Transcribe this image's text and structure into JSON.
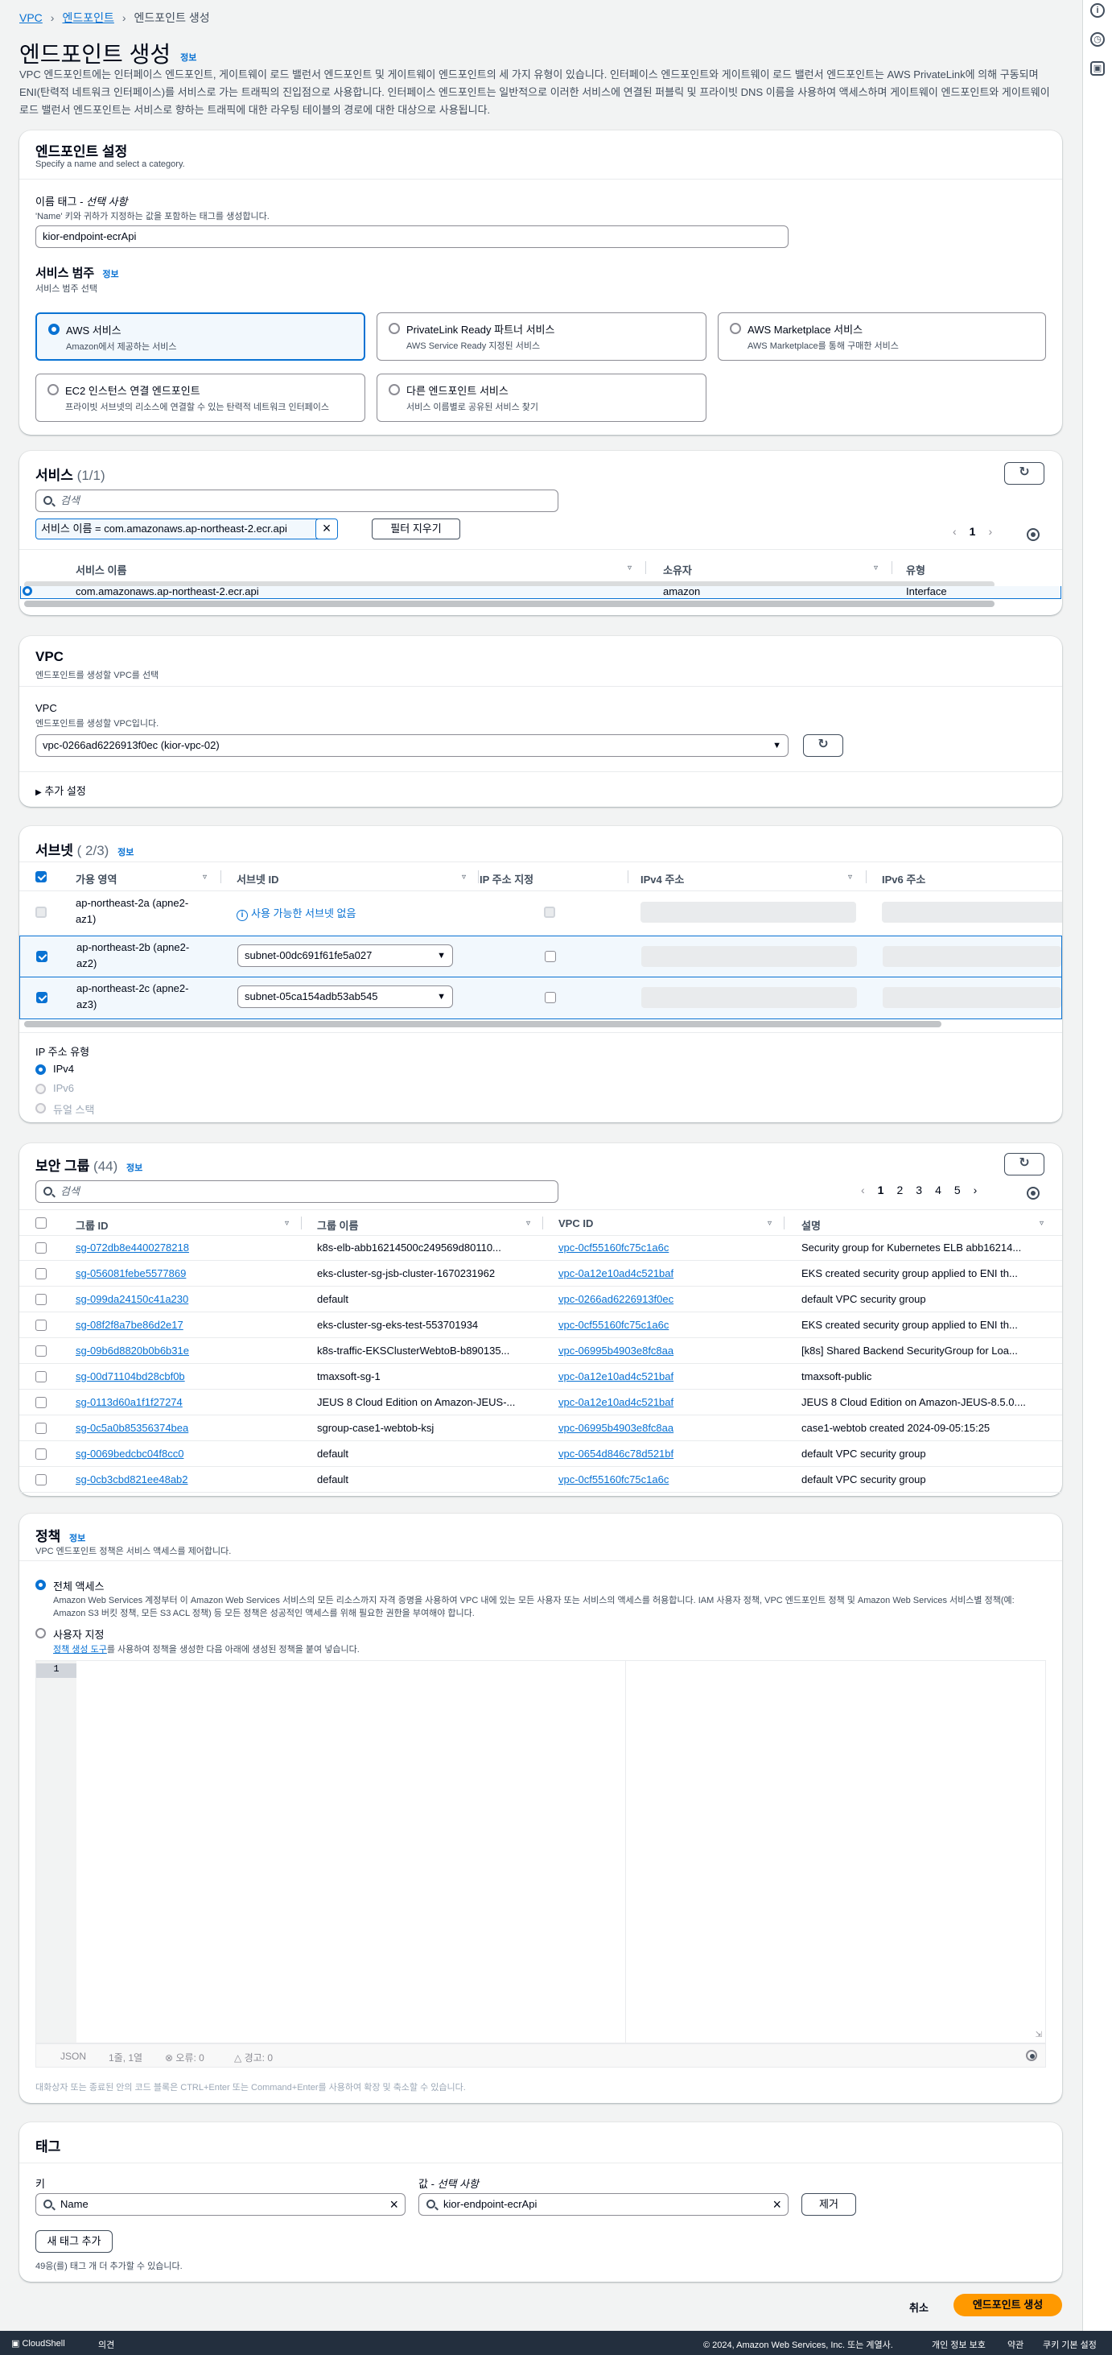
{
  "breadcrumb": {
    "items": [
      "VPC",
      "엔드포인트",
      "엔드포인트 생성"
    ]
  },
  "page": {
    "title": "엔드포인트 생성",
    "info": "정보",
    "description": "VPC 엔드포인트에는 인터페이스 엔드포인트, 게이트웨이 로드 밸런서 엔드포인트 및 게이트웨이 엔드포인트의 세 가지 유형이 있습니다. 인터페이스 엔드포인트와 게이트웨이 로드 밸런서 엔드포인트는 AWS PrivateLink에 의해 구동되며 ENI(탄력적 네트워크 인터페이스)를 서비스로 가는 트래픽의 진입점으로 사용합니다. 인터페이스 엔드포인트는 일반적으로 이러한 서비스에 연결된 퍼블릭 및 프라이빗 DNS 이름을 사용하여 액세스하며 게이트웨이 엔드포인트와 게이트웨이 로드 밸런서 엔드포인트는 서비스로 향하는 트래픽에 대한 라우팅 테이블의 경로에 대한 대상으로 사용됩니다."
  },
  "endpoint_settings": {
    "title": "엔드포인트 설정",
    "subtitle": "Specify a name and select a category.",
    "name_label": "이름 태그 - ",
    "name_optional": "선택 사항",
    "name_hint": "'Name' 키와 귀하가 지정하는 값을 포함하는 태그를 생성합니다.",
    "name_value": "kior-endpoint-ecrApi",
    "category_title": "서비스 범주",
    "category_info": "정보",
    "category_hint": "서비스 범주 선택",
    "tiles": [
      {
        "title": "AWS 서비스",
        "desc": "Amazon에서 제공하는 서비스"
      },
      {
        "title": "PrivateLink Ready 파트너 서비스",
        "desc": "AWS Service Ready 지정된 서비스"
      },
      {
        "title": "AWS Marketplace 서비스",
        "desc": "AWS Marketplace를 통해 구매한 서비스"
      },
      {
        "title": "EC2 인스턴스 연결 엔드포인트",
        "desc": "프라이빗 서브넷의 리소스에 연결할 수 있는 탄력적 네트워크 인터페이스"
      },
      {
        "title": "다른 엔드포인트 서비스",
        "desc": "서비스 이름별로 공유된 서비스 찾기"
      }
    ]
  },
  "services": {
    "title": "서비스",
    "count": "(1/1)",
    "search_placeholder": "검색",
    "filter_token": "서비스 이름 = com.amazonaws.ap-northeast-2.ecr.api",
    "clear_filters": "필터 지우기",
    "page": "1",
    "columns": [
      "서비스 이름",
      "소유자",
      "유형"
    ],
    "row": {
      "name": "com.amazonaws.ap-northeast-2.ecr.api",
      "owner": "amazon",
      "type": "Interface"
    }
  },
  "vpc": {
    "title": "VPC",
    "subtitle": "엔드포인트를 생성할 VPC를 선택",
    "label": "VPC",
    "hint": "엔드포인트를 생성할 VPC입니다.",
    "value": "vpc-0266ad6226913f0ec (kior-vpc-02)",
    "additional": "추가 설정"
  },
  "subnets": {
    "title": "서브넷",
    "count": "( 2/3)",
    "info": "정보",
    "columns": [
      "가용 영역",
      "서브넷 ID",
      "IP 주소 지정",
      "IPv4 주소",
      "IPv6 주소"
    ],
    "rows": [
      {
        "az1": "ap-northeast-2a (apne2-",
        "az2": "az1)",
        "subnet": "사용 가능한 서브넷 없음"
      },
      {
        "az1": "ap-northeast-2b (apne2-",
        "az2": "az2)",
        "subnet": "subnet-00dc691f61fe5a027"
      },
      {
        "az1": "ap-northeast-2c (apne2-",
        "az2": "az3)",
        "subnet": "subnet-05ca154adb53ab545"
      }
    ],
    "ip_type_label": "IP 주소 유형",
    "ip_types": [
      "IPv4",
      "IPv6",
      "듀얼 스택"
    ]
  },
  "security_groups": {
    "title": "보안 그룹",
    "count": "(44)",
    "info": "정보",
    "search_placeholder": "검색",
    "pages": [
      "1",
      "2",
      "3",
      "4",
      "5"
    ],
    "columns": [
      "그룹 ID",
      "그룹 이름",
      "VPC ID",
      "설명"
    ],
    "rows": [
      {
        "id": "sg-072db8e4400278218",
        "name": "k8s-elb-abb16214500c249569d80110...",
        "vpc": "vpc-0cf55160fc75c1a6c",
        "desc": "Security group for Kubernetes ELB abb16214..."
      },
      {
        "id": "sg-056081febe5577869",
        "name": "eks-cluster-sg-jsb-cluster-1670231962",
        "vpc": "vpc-0a12e10ad4c521baf",
        "desc": "EKS created security group applied to ENI th..."
      },
      {
        "id": "sg-099da24150c41a230",
        "name": "default",
        "vpc": "vpc-0266ad6226913f0ec",
        "desc": "default VPC security group"
      },
      {
        "id": "sg-08f2f8a7be86d2e17",
        "name": "eks-cluster-sg-eks-test-553701934",
        "vpc": "vpc-0cf55160fc75c1a6c",
        "desc": "EKS created security group applied to ENI th..."
      },
      {
        "id": "sg-09b6d8820b0b6b31e",
        "name": "k8s-traffic-EKSClusterWebtoB-b890135...",
        "vpc": "vpc-06995b4903e8fc8aa",
        "desc": "[k8s] Shared Backend SecurityGroup for Loa..."
      },
      {
        "id": "sg-00d71104bd28cbf0b",
        "name": "tmaxsoft-sg-1",
        "vpc": "vpc-0a12e10ad4c521baf",
        "desc": "tmaxsoft-public"
      },
      {
        "id": "sg-0113d60a1f1f27274",
        "name": "JEUS 8 Cloud Edition on Amazon-JEUS-...",
        "vpc": "vpc-0a12e10ad4c521baf",
        "desc": "JEUS 8 Cloud Edition on Amazon-JEUS-8.5.0...."
      },
      {
        "id": "sg-0c5a0b85356374bea",
        "name": "sgroup-case1-webtob-ksj",
        "vpc": "vpc-06995b4903e8fc8aa",
        "desc": "case1-webtob created 2024-09-05:15:25"
      },
      {
        "id": "sg-0069bedcbc04f8cc0",
        "name": "default",
        "vpc": "vpc-0654d846c78d521bf",
        "desc": "default VPC security group"
      },
      {
        "id": "sg-0cb3cbd821ee48ab2",
        "name": "default",
        "vpc": "vpc-0cf55160fc75c1a6c",
        "desc": "default VPC security group"
      }
    ]
  },
  "policy": {
    "title": "정책",
    "info": "정보",
    "subtitle": "VPC 엔드포인트 정책은 서비스 액세스를 제어합니다.",
    "full_access": "전체 액세스",
    "full_access_desc": "Amazon Web Services 계정부터 이 Amazon Web Services 서비스의 모든 리소스까지 자격 증명을 사용하여 VPC 내에 있는 모든 사용자 또는 서비스의 액세스를 허용합니다. IAM 사용자 정책, VPC 엔드포인트 정책 및 Amazon Web Services 서비스별 정책(예: Amazon S3 버킷 정책, 모든 S3 ACL 정책) 등 모든 정책은 성공적인 액세스를 위해 필요한 권한을 부여해야 합니다.",
    "custom": "사용자 지정",
    "custom_link": "정책 생성 도구",
    "custom_desc": "를 사용하여 정책을 생성한 다음 아래에 생성된 정책을 붙여 넣습니다.",
    "line_number": "1",
    "status_lang": "JSON",
    "status_pos": "1줄, 1열",
    "status_errors": "오류: 0",
    "status_warnings": "경고: 0",
    "editor_hint": "대화상자 또는 종료된 안의 코드 블록은 CTRL+Enter 또는 Command+Enter를 사용하여 확장 및 축소할 수 있습니다."
  },
  "tags": {
    "title": "태그",
    "key_label": "키",
    "value_label": "값 - ",
    "value_optional": "선택 사항",
    "key_value": "Name",
    "value_value": "kior-endpoint-ecrApi",
    "remove": "제거",
    "add": "새 태그 추가",
    "limit": "49응(를) 태그 개 더 추가할 수 있습니다."
  },
  "actions": {
    "cancel": "취소",
    "create": "엔드포인트 생성"
  },
  "footer": {
    "cloudshell": "CloudShell",
    "feedback": "의견",
    "copyright": "© 2024, Amazon Web Services, Inc. 또는 계열사.",
    "privacy": "개인 정보 보호",
    "terms": "약관",
    "cookies": "쿠키 기본 설정"
  },
  "colors": {
    "accent": "#0972d3",
    "primary": "#ff9900",
    "footer": "#232f3e"
  }
}
